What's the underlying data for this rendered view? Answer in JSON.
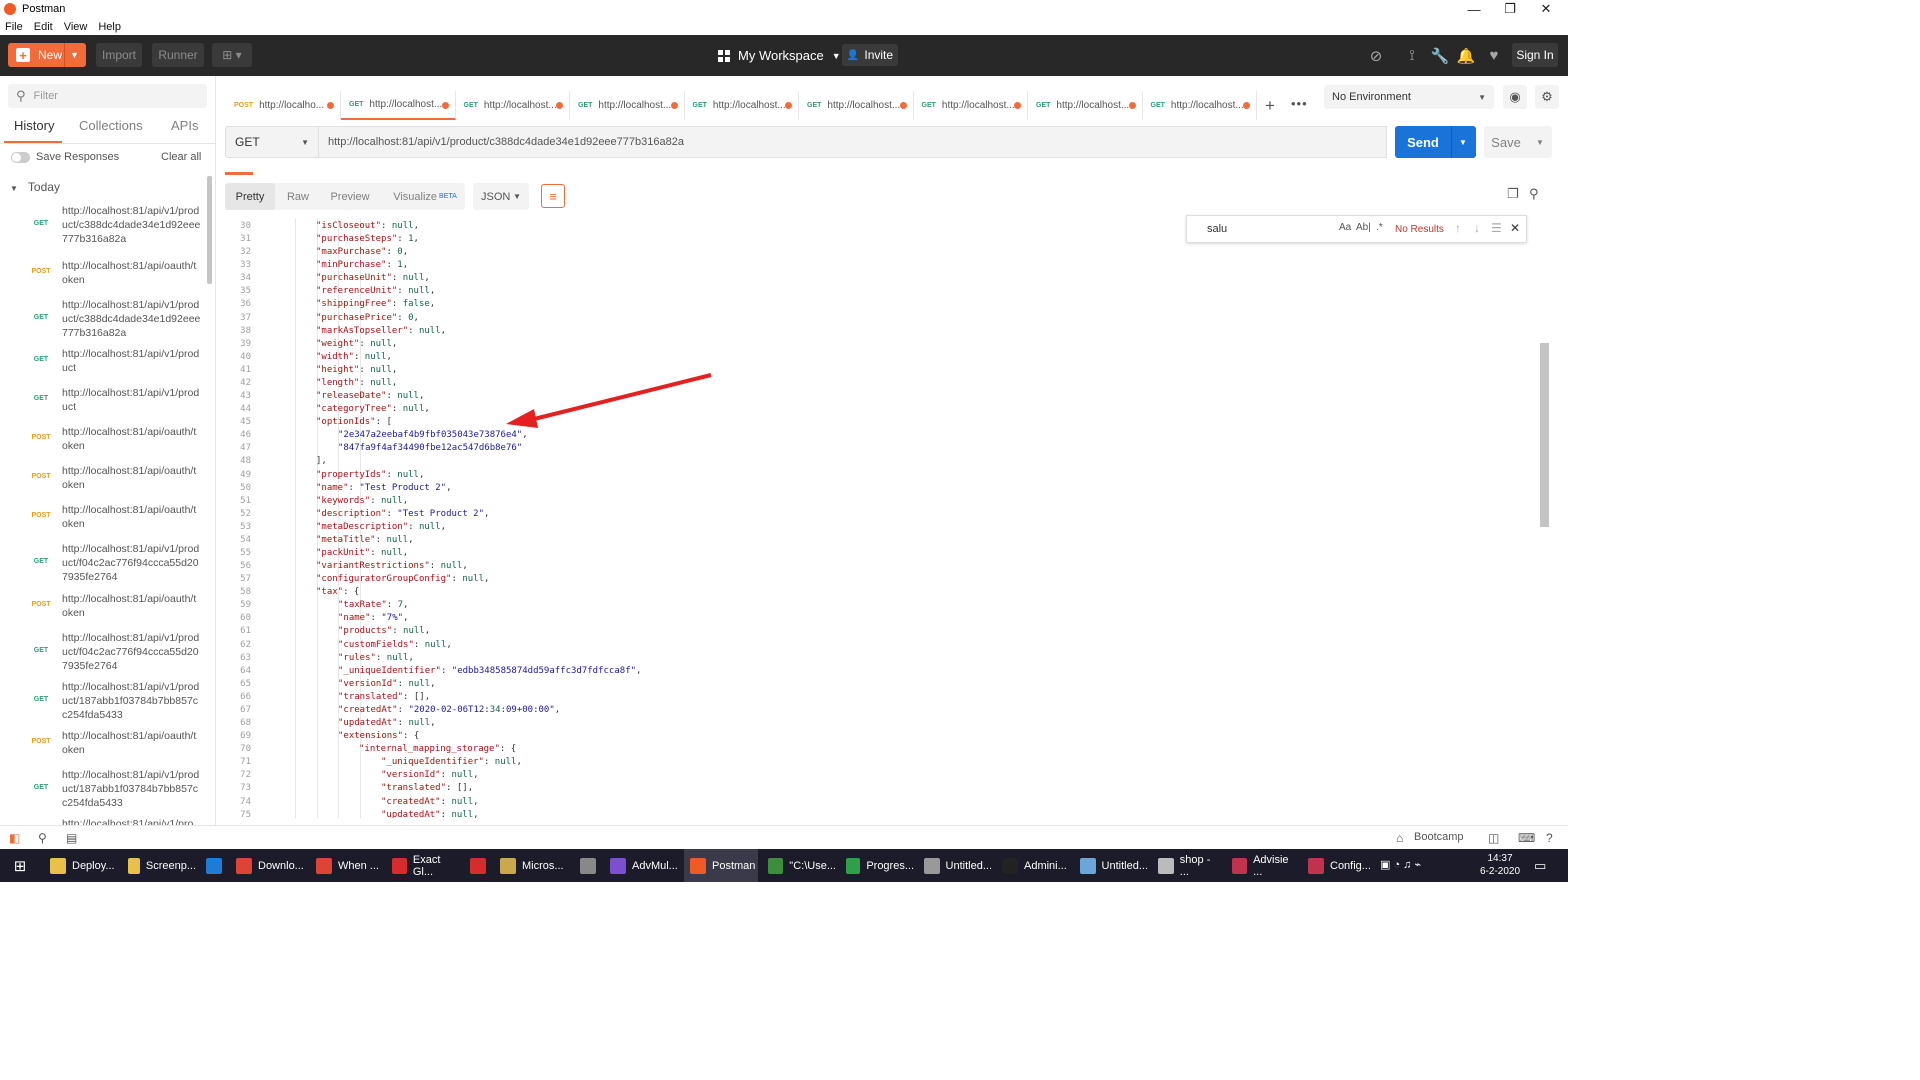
{
  "window": {
    "title": "Postman",
    "minimize": "—",
    "maximize": "❐",
    "close": "✕"
  },
  "menu": [
    "File",
    "Edit",
    "View",
    "Help"
  ],
  "header": {
    "new_label": "New",
    "import_label": "Import",
    "runner_label": "Runner",
    "workspace_label": "My Workspace",
    "invite_label": "Invite",
    "signin_label": "Sign In"
  },
  "sidebar": {
    "filter_placeholder": "Filter",
    "tabs": [
      "History",
      "Collections",
      "APIs"
    ],
    "save_responses_label": "Save Responses",
    "clear_all_label": "Clear all",
    "group_label": "Today",
    "items": [
      {
        "method": "GET",
        "url": "http://localhost:81/api/v1/product/c388dc4dade34e1d92eee777b316a82a"
      },
      {
        "method": "POST",
        "url": "http://localhost:81/api/oauth/token"
      },
      {
        "method": "GET",
        "url": "http://localhost:81/api/v1/product/c388dc4dade34e1d92eee777b316a82a"
      },
      {
        "method": "GET",
        "url": "http://localhost:81/api/v1/product"
      },
      {
        "method": "GET",
        "url": "http://localhost:81/api/v1/product"
      },
      {
        "method": "POST",
        "url": "http://localhost:81/api/oauth/token"
      },
      {
        "method": "POST",
        "url": "http://localhost:81/api/oauth/token"
      },
      {
        "method": "POST",
        "url": "http://localhost:81/api/oauth/token"
      },
      {
        "method": "GET",
        "url": "http://localhost:81/api/v1/product/f04c2ac776f94ccca55d207935fe2764"
      },
      {
        "method": "POST",
        "url": "http://localhost:81/api/oauth/token"
      },
      {
        "method": "GET",
        "url": "http://localhost:81/api/v1/product/f04c2ac776f94ccca55d207935fe2764"
      },
      {
        "method": "GET",
        "url": "http://localhost:81/api/v1/product/187abb1f03784b7bb857cc254fda5433"
      },
      {
        "method": "POST",
        "url": "http://localhost:81/api/oauth/token"
      },
      {
        "method": "GET",
        "url": "http://localhost:81/api/v1/product/187abb1f03784b7bb857cc254fda5433"
      },
      {
        "method": "GET",
        "url": "http://localhost:81/api/v1/pro"
      }
    ]
  },
  "request_tabs": [
    {
      "method": "POST",
      "label": "http://localho..."
    },
    {
      "method": "GET",
      "label": "http://localhost..."
    },
    {
      "method": "GET",
      "label": "http://localhost..."
    },
    {
      "method": "GET",
      "label": "http://localhost..."
    },
    {
      "method": "GET",
      "label": "http://localhost..."
    },
    {
      "method": "GET",
      "label": "http://localhost..."
    },
    {
      "method": "GET",
      "label": "http://localhost..."
    },
    {
      "method": "GET",
      "label": "http://localhost..."
    },
    {
      "method": "GET",
      "label": "http://localhost..."
    }
  ],
  "environment": "No Environment",
  "request": {
    "method": "GET",
    "url": "http://localhost:81/api/v1/product/c388dc4dade34e1d92eee777b316a82a",
    "send_label": "Send",
    "save_label": "Save"
  },
  "response": {
    "view_tabs": [
      "Pretty",
      "Raw",
      "Preview",
      "Visualize"
    ],
    "beta_label": "BETA",
    "format": "JSON",
    "find": {
      "query": "salu",
      "match_case": "Aa",
      "whole_word": "Ab|",
      "regex": ".*",
      "result": "No Results"
    },
    "lines": [
      {
        "n": "30",
        "indent": 2,
        "t": "\"isCloseout\": null,"
      },
      {
        "n": "31",
        "indent": 2,
        "t": "\"purchaseSteps\": 1,"
      },
      {
        "n": "32",
        "indent": 2,
        "t": "\"maxPurchase\": 0,"
      },
      {
        "n": "33",
        "indent": 2,
        "t": "\"minPurchase\": 1,"
      },
      {
        "n": "34",
        "indent": 2,
        "t": "\"purchaseUnit\": null,"
      },
      {
        "n": "35",
        "indent": 2,
        "t": "\"referenceUnit\": null,"
      },
      {
        "n": "36",
        "indent": 2,
        "t": "\"shippingFree\": false,"
      },
      {
        "n": "37",
        "indent": 2,
        "t": "\"purchasePrice\": 0,"
      },
      {
        "n": "38",
        "indent": 2,
        "t": "\"markAsTopseller\": null,"
      },
      {
        "n": "39",
        "indent": 2,
        "t": "\"weight\": null,"
      },
      {
        "n": "40",
        "indent": 2,
        "t": "\"width\": null,"
      },
      {
        "n": "41",
        "indent": 2,
        "t": "\"height\": null,"
      },
      {
        "n": "42",
        "indent": 2,
        "t": "\"length\": null,"
      },
      {
        "n": "43",
        "indent": 2,
        "t": "\"releaseDate\": null,"
      },
      {
        "n": "44",
        "indent": 2,
        "t": "\"categoryTree\": null,"
      },
      {
        "n": "45",
        "indent": 2,
        "t": "\"optionIds\": ["
      },
      {
        "n": "46",
        "indent": 3,
        "t": "\"2e347a2eebaf4b9fbf035043e73876e4\","
      },
      {
        "n": "47",
        "indent": 3,
        "t": "\"847fa9f4af34490fbe12ac547d6b8e76\""
      },
      {
        "n": "48",
        "indent": 2,
        "t": "],"
      },
      {
        "n": "49",
        "indent": 2,
        "t": "\"propertyIds\": null,"
      },
      {
        "n": "50",
        "indent": 2,
        "t": "\"name\": \"Test Product 2\","
      },
      {
        "n": "51",
        "indent": 2,
        "t": "\"keywords\": null,"
      },
      {
        "n": "52",
        "indent": 2,
        "t": "\"description\": \"Test Product 2\","
      },
      {
        "n": "53",
        "indent": 2,
        "t": "\"metaDescription\": null,"
      },
      {
        "n": "54",
        "indent": 2,
        "t": "\"metaTitle\": null,"
      },
      {
        "n": "55",
        "indent": 2,
        "t": "\"packUnit\": null,"
      },
      {
        "n": "56",
        "indent": 2,
        "t": "\"variantRestrictions\": null,"
      },
      {
        "n": "57",
        "indent": 2,
        "t": "\"configuratorGroupConfig\": null,"
      },
      {
        "n": "58",
        "indent": 2,
        "t": "\"tax\": {"
      },
      {
        "n": "59",
        "indent": 3,
        "t": "\"taxRate\": 7,"
      },
      {
        "n": "60",
        "indent": 3,
        "t": "\"name\": \"7%\","
      },
      {
        "n": "61",
        "indent": 3,
        "t": "\"products\": null,"
      },
      {
        "n": "62",
        "indent": 3,
        "t": "\"customFields\": null,"
      },
      {
        "n": "63",
        "indent": 3,
        "t": "\"rules\": null,"
      },
      {
        "n": "64",
        "indent": 3,
        "t": "\"_uniqueIdentifier\": \"edbb348585874dd59affc3d7fdfcca8f\","
      },
      {
        "n": "65",
        "indent": 3,
        "t": "\"versionId\": null,"
      },
      {
        "n": "66",
        "indent": 3,
        "t": "\"translated\": [],"
      },
      {
        "n": "67",
        "indent": 3,
        "t": "\"createdAt\": \"2020-02-06T12:34:09+00:00\","
      },
      {
        "n": "68",
        "indent": 3,
        "t": "\"updatedAt\": null,"
      },
      {
        "n": "69",
        "indent": 3,
        "t": "\"extensions\": {"
      },
      {
        "n": "70",
        "indent": 4,
        "t": "\"internal_mapping_storage\": {"
      },
      {
        "n": "71",
        "indent": 5,
        "t": "\"_uniqueIdentifier\": null,"
      },
      {
        "n": "72",
        "indent": 5,
        "t": "\"versionId\": null,"
      },
      {
        "n": "73",
        "indent": 5,
        "t": "\"translated\": [],"
      },
      {
        "n": "74",
        "indent": 5,
        "t": "\"createdAt\": null,"
      },
      {
        "n": "75",
        "indent": 5,
        "t": "\"updatedAt\": null,"
      }
    ]
  },
  "statusbar": {
    "bootcamp_label": "Bootcamp"
  },
  "taskbar": {
    "items": [
      {
        "label": "Deploy...",
        "color": "#e8c04a"
      },
      {
        "label": "Screenp...",
        "color": "#e8c04a"
      },
      {
        "label": "",
        "color": "#1e7bd6"
      },
      {
        "label": "Downlo...",
        "color": "#db4437"
      },
      {
        "label": "When ...",
        "color": "#db4437"
      },
      {
        "label": "Exact Gl...",
        "color": "#d92b2b"
      },
      {
        "label": "",
        "color": "#d92b2b"
      },
      {
        "label": "Micros...",
        "color": "#c9a94b"
      },
      {
        "label": "",
        "color": "#888888"
      },
      {
        "label": "AdvMul...",
        "color": "#7b4fd0"
      },
      {
        "label": "Postman",
        "color": "#ef5b25"
      },
      {
        "label": "\"C:\\Use...",
        "color": "#3c8d3c"
      },
      {
        "label": "Progres...",
        "color": "#2ea04a"
      },
      {
        "label": "Untitled...",
        "color": "#999999"
      },
      {
        "label": "Admini...",
        "color": "#222222"
      },
      {
        "label": "Untitled...",
        "color": "#6aa7d8"
      },
      {
        "label": "shop - ...",
        "color": "#bbbbbb"
      },
      {
        "label": "Advisie ...",
        "color": "#c0334d"
      },
      {
        "label": "Config...",
        "color": "#c0334d"
      }
    ],
    "time": "14:37",
    "date": "6-2-2020"
  }
}
